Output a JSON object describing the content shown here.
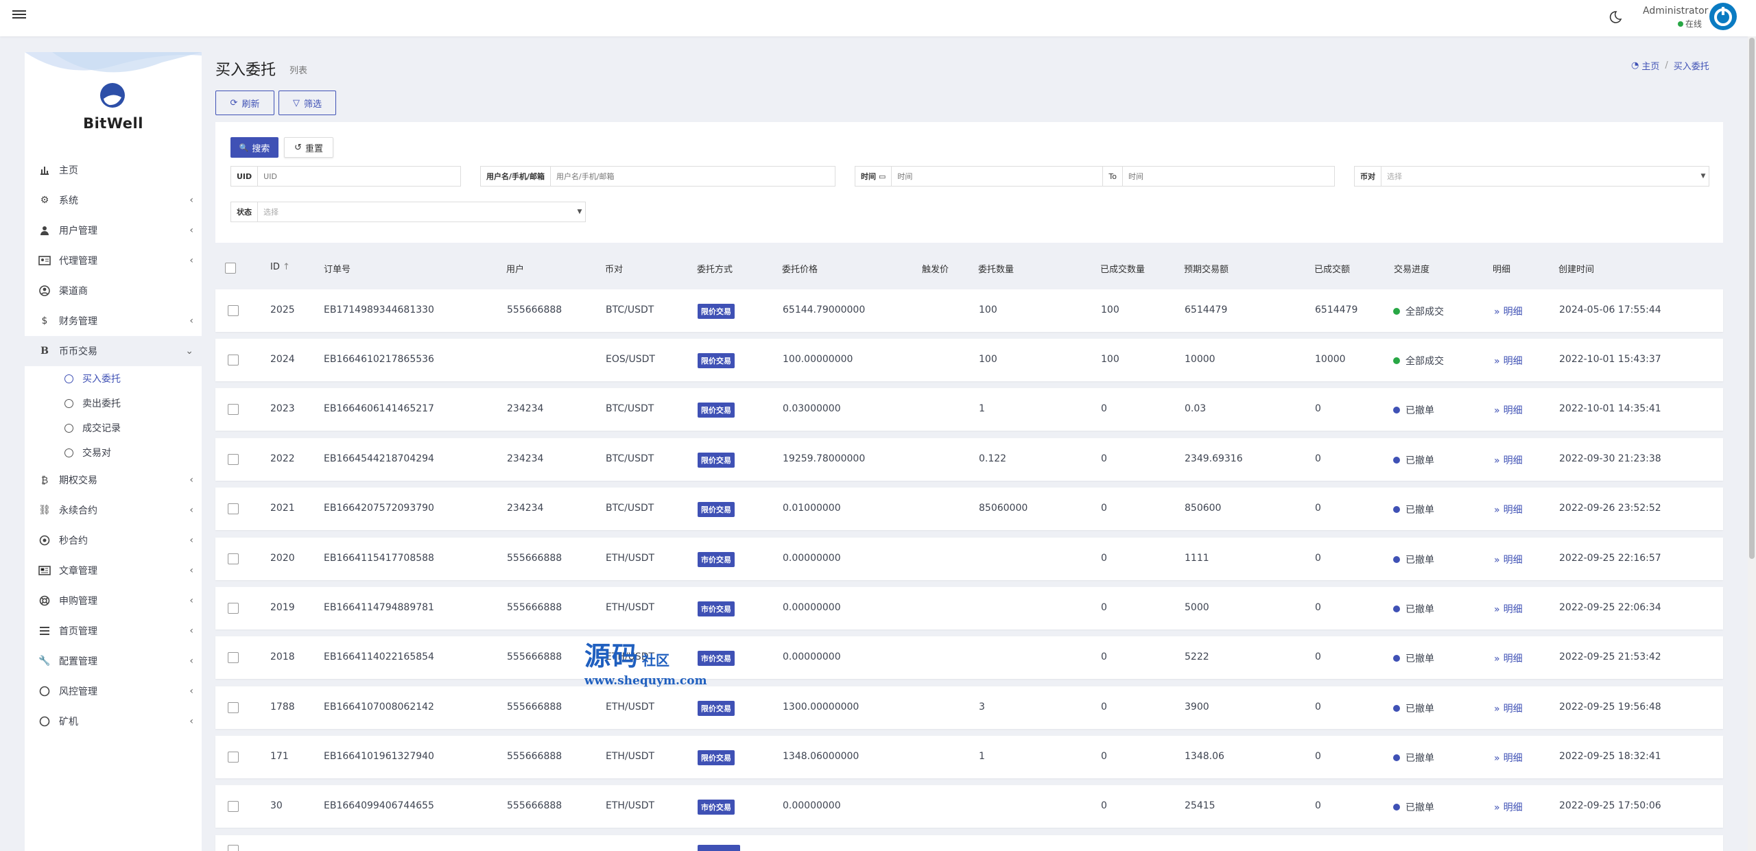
{
  "header": {
    "user_name": "Administrator",
    "status": "在线"
  },
  "sidebar": {
    "brand": "BitWell",
    "items": [
      {
        "label": "主页",
        "icon": "bar-chart-icon",
        "chevron": false
      },
      {
        "label": "系统",
        "icon": "gear-icon",
        "chevron": true
      },
      {
        "label": "用户管理",
        "icon": "user-icon",
        "chevron": true
      },
      {
        "label": "代理管理",
        "icon": "id-card-icon",
        "chevron": true
      },
      {
        "label": "渠道商",
        "icon": "user-circle-icon",
        "chevron": false
      },
      {
        "label": "财务管理",
        "icon": "dollar-icon",
        "chevron": true
      },
      {
        "label": "币币交易",
        "icon": "bitcoin-icon",
        "chevron": true,
        "active": true
      },
      {
        "label": "期权交易",
        "icon": "bitcoin-icon",
        "chevron": true
      },
      {
        "label": "永续合约",
        "icon": "link-icon",
        "chevron": true
      },
      {
        "label": "秒合约",
        "icon": "dot-circle-icon",
        "chevron": true
      },
      {
        "label": "文章管理",
        "icon": "newspaper-icon",
        "chevron": true
      },
      {
        "label": "申购管理",
        "icon": "lifebuoy-icon",
        "chevron": true
      },
      {
        "label": "首页管理",
        "icon": "list-icon",
        "chevron": true
      },
      {
        "label": "配置管理",
        "icon": "wrench-icon",
        "chevron": true
      },
      {
        "label": "风控管理",
        "icon": "circle-icon",
        "chevron": true
      },
      {
        "label": "矿机",
        "icon": "circle-icon",
        "chevron": true
      }
    ],
    "sub_items": [
      "买入委托",
      "卖出委托",
      "成交记录",
      "交易对"
    ]
  },
  "page": {
    "title": "买入委托",
    "subtitle": "列表"
  },
  "breadcrumb": {
    "home": "主页",
    "current": "买入委托"
  },
  "toolbar": {
    "refresh": "刷新",
    "filter": "筛选"
  },
  "filter": {
    "search": "搜索",
    "reset": "重置",
    "uid_label": "UID",
    "uid_placeholder": "UID",
    "user_label": "用户名/手机/邮箱",
    "user_placeholder": "用户名/手机/邮箱",
    "time_label": "时间",
    "time_placeholder": "时间",
    "to_label": "To",
    "time_to_placeholder": "时间",
    "pair_label": "币对",
    "pair_value": "选择",
    "status_label": "状态",
    "status_value": "选择"
  },
  "table": {
    "headers": [
      "ID",
      "订单号",
      "用户",
      "币对",
      "委托方式",
      "委托价格",
      "触发价",
      "委托数量",
      "已成交数量",
      "预期交易额",
      "已成交额",
      "交易进度",
      "明细",
      "创建时间"
    ],
    "rows": [
      {
        "id": "2025",
        "order": "EB1714989344681330",
        "user": "555666888",
        "pair": "BTC/USDT",
        "type": "限价交易",
        "price": "65144.79000000",
        "trigger": "",
        "qty": "100",
        "filled": "100",
        "expected": "6514479",
        "filled_amt": "6514479",
        "progress": "全部成交",
        "color": "#28a745",
        "detail": "明细",
        "created": "2024-05-06 17:55:44"
      },
      {
        "id": "2024",
        "order": "EB1664610217865536",
        "user": "",
        "pair": "EOS/USDT",
        "type": "限价交易",
        "price": "100.00000000",
        "trigger": "",
        "qty": "100",
        "filled": "100",
        "expected": "10000",
        "filled_amt": "10000",
        "progress": "全部成交",
        "color": "#28a745",
        "detail": "明细",
        "created": "2022-10-01 15:43:37"
      },
      {
        "id": "2023",
        "order": "EB1664606141465217",
        "user": "234234",
        "pair": "BTC/USDT",
        "type": "限价交易",
        "price": "0.03000000",
        "trigger": "",
        "qty": "1",
        "filled": "0",
        "expected": "0.03",
        "filled_amt": "0",
        "progress": "已撤单",
        "color": "#3f51b5",
        "detail": "明细",
        "created": "2022-10-01 14:35:41"
      },
      {
        "id": "2022",
        "order": "EB1664544218704294",
        "user": "234234",
        "pair": "BTC/USDT",
        "type": "限价交易",
        "price": "19259.78000000",
        "trigger": "",
        "qty": "0.122",
        "filled": "0",
        "expected": "2349.69316",
        "filled_amt": "0",
        "progress": "已撤单",
        "color": "#3f51b5",
        "detail": "明细",
        "created": "2022-09-30 21:23:38"
      },
      {
        "id": "2021",
        "order": "EB1664207572093790",
        "user": "234234",
        "pair": "BTC/USDT",
        "type": "限价交易",
        "price": "0.01000000",
        "trigger": "",
        "qty": "85060000",
        "filled": "0",
        "expected": "850600",
        "filled_amt": "0",
        "progress": "已撤单",
        "color": "#3f51b5",
        "detail": "明细",
        "created": "2022-09-26 23:52:52"
      },
      {
        "id": "2020",
        "order": "EB1664115417708588",
        "user": "555666888",
        "pair": "ETH/USDT",
        "type": "市价交易",
        "price": "0.00000000",
        "trigger": "",
        "qty": "",
        "filled": "0",
        "expected": "1111",
        "filled_amt": "0",
        "progress": "已撤单",
        "color": "#3f51b5",
        "detail": "明细",
        "created": "2022-09-25 22:16:57"
      },
      {
        "id": "2019",
        "order": "EB1664114794889781",
        "user": "555666888",
        "pair": "ETH/USDT",
        "type": "市价交易",
        "price": "0.00000000",
        "trigger": "",
        "qty": "",
        "filled": "0",
        "expected": "5000",
        "filled_amt": "0",
        "progress": "已撤单",
        "color": "#3f51b5",
        "detail": "明细",
        "created": "2022-09-25 22:06:34"
      },
      {
        "id": "2018",
        "order": "EB1664114022165854",
        "user": "555666888",
        "pair": "ETH/USDT",
        "type": "市价交易",
        "price": "0.00000000",
        "trigger": "",
        "qty": "",
        "filled": "0",
        "expected": "5222",
        "filled_amt": "0",
        "progress": "已撤单",
        "color": "#3f51b5",
        "detail": "明细",
        "created": "2022-09-25 21:53:42"
      },
      {
        "id": "1788",
        "order": "EB1664107008062142",
        "user": "555666888",
        "pair": "ETH/USDT",
        "type": "限价交易",
        "price": "1300.00000000",
        "trigger": "",
        "qty": "3",
        "filled": "0",
        "expected": "3900",
        "filled_amt": "0",
        "progress": "已撤单",
        "color": "#3f51b5",
        "detail": "明细",
        "created": "2022-09-25 19:56:48"
      },
      {
        "id": "171",
        "order": "EB1664101961327940",
        "user": "555666888",
        "pair": "ETH/USDT",
        "type": "限价交易",
        "price": "1348.06000000",
        "trigger": "",
        "qty": "1",
        "filled": "0",
        "expected": "1348.06",
        "filled_amt": "0",
        "progress": "已撤单",
        "color": "#3f51b5",
        "detail": "明细",
        "created": "2022-09-25 18:32:41"
      },
      {
        "id": "30",
        "order": "EB1664099406744655",
        "user": "555666888",
        "pair": "ETH/USDT",
        "type": "市价交易",
        "price": "0.00000000",
        "trigger": "",
        "qty": "",
        "filled": "0",
        "expected": "25415",
        "filled_amt": "0",
        "progress": "已撤单",
        "color": "#3f51b5",
        "detail": "明细",
        "created": "2022-09-25 17:50:06"
      }
    ]
  },
  "watermark": {
    "big": "源码",
    "small": "社区",
    "url": "www.shequym.com"
  }
}
